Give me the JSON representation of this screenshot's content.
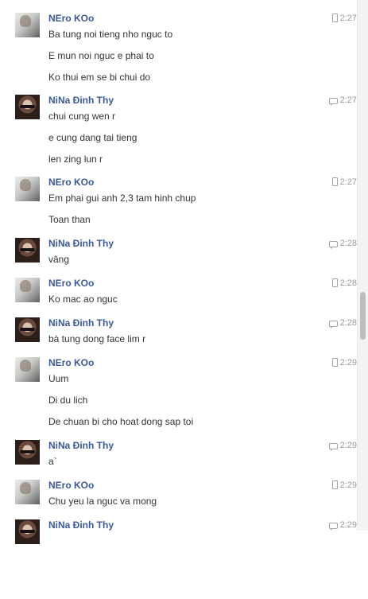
{
  "messages": [
    {
      "sender": "NEro KOo",
      "avatar": "nero",
      "source": "mobile-icon",
      "time": "2:27",
      "lines": [
        "Ba tung noi tieng nho nguc to",
        "E mun noi nguc e phai to",
        "Ko thui em se bi chui do"
      ]
    },
    {
      "sender": "NiNa Đinh Thy",
      "avatar": "nina",
      "source": "chat-icon",
      "time": "2:27",
      "lines": [
        "chui cung wen r",
        "e cung dang tai tieng",
        "len zing lun r"
      ]
    },
    {
      "sender": "NEro KOo",
      "avatar": "nero",
      "source": "mobile-icon",
      "time": "2:27",
      "lines": [
        "Em phai gui anh 2,3 tam hinh chup",
        "Toan than"
      ]
    },
    {
      "sender": "NiNa Đinh Thy",
      "avatar": "nina",
      "source": "chat-icon",
      "time": "2:28",
      "lines": [
        "vâng"
      ]
    },
    {
      "sender": "NEro KOo",
      "avatar": "nero",
      "source": "mobile-icon",
      "time": "2:28",
      "lines": [
        "Ko mac ao nguc"
      ]
    },
    {
      "sender": "NiNa Đinh Thy",
      "avatar": "nina",
      "source": "chat-icon",
      "time": "2:28",
      "lines": [
        "bà tung dong face lim r"
      ]
    },
    {
      "sender": "NEro KOo",
      "avatar": "nero",
      "source": "mobile-icon",
      "time": "2:29",
      "lines": [
        "Uum",
        "Di du lich",
        "De chuan bi cho hoat dong sap toi"
      ]
    },
    {
      "sender": "NiNa Đinh Thy",
      "avatar": "nina",
      "source": "chat-icon",
      "time": "2:29",
      "lines": [
        "a`"
      ]
    },
    {
      "sender": "NEro KOo",
      "avatar": "nero",
      "source": "mobile-icon",
      "time": "2:29",
      "lines": [
        "Chu yeu la nguc va mong"
      ]
    },
    {
      "sender": "NiNa Đinh Thy",
      "avatar": "nina",
      "source": "chat-icon",
      "time": "2:29",
      "lines": []
    }
  ],
  "colors": {
    "sender_name": "#3b5998",
    "message_text": "#333333",
    "timestamp": "#9a9a9a",
    "background": "#ffffff"
  },
  "scrollbar": {
    "position_fraction": 0.55
  }
}
